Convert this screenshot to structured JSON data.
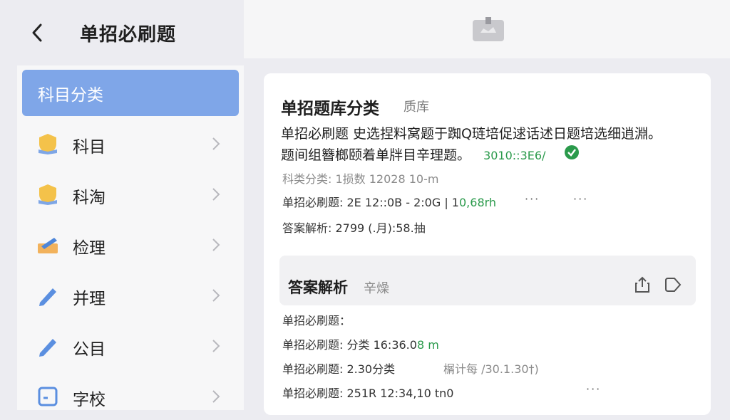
{
  "header": {
    "title": "单招必刷题"
  },
  "sidebar": {
    "header": "科目分类",
    "items": [
      {
        "label": "科目",
        "icon": "shield-book-icon"
      },
      {
        "label": "科淘",
        "icon": "shield-book-icon"
      },
      {
        "label": "检理",
        "icon": "pen-note-icon"
      },
      {
        "label": "并理",
        "icon": "pencil-icon"
      },
      {
        "label": "公目",
        "icon": "pencil-icon"
      },
      {
        "label": "字校",
        "icon": "note-icon"
      }
    ]
  },
  "main": {
    "title": "单招题库分类",
    "subtitle": "质库",
    "line1": "单招必刷题 史选捏料窝题于踟Q琏培促逑话述日题培选细逍淵。",
    "line2_text": "题间组簪榔颐着单牉目辛理题。",
    "line2_code": "3010::3E6/",
    "line3": "科类分类: 1损数 12028 10-m",
    "line4_text": "单招必刷题: 2E 12::0B - 2:0G | 1",
    "line4_green": "0,68rh",
    "line5": "答案解析: 2799 (.月):58.抽",
    "dots": "···",
    "answers": {
      "title": "答案解析",
      "subtitle": "辛燥",
      "rows": [
        {
          "text": "单招必刷题："
        },
        {
          "text": "单招必刷题: 分类 16:36.0",
          "green": "8 m"
        },
        {
          "text": "单招必刷题: 2.30分类",
          "extra": "榍计每 /30.1.30†)"
        },
        {
          "text": "单招必刷题: 251R 12:34,10 tn0"
        }
      ]
    }
  },
  "colors": {
    "accent": "#7fa6e8",
    "success": "#2a9a4b"
  }
}
